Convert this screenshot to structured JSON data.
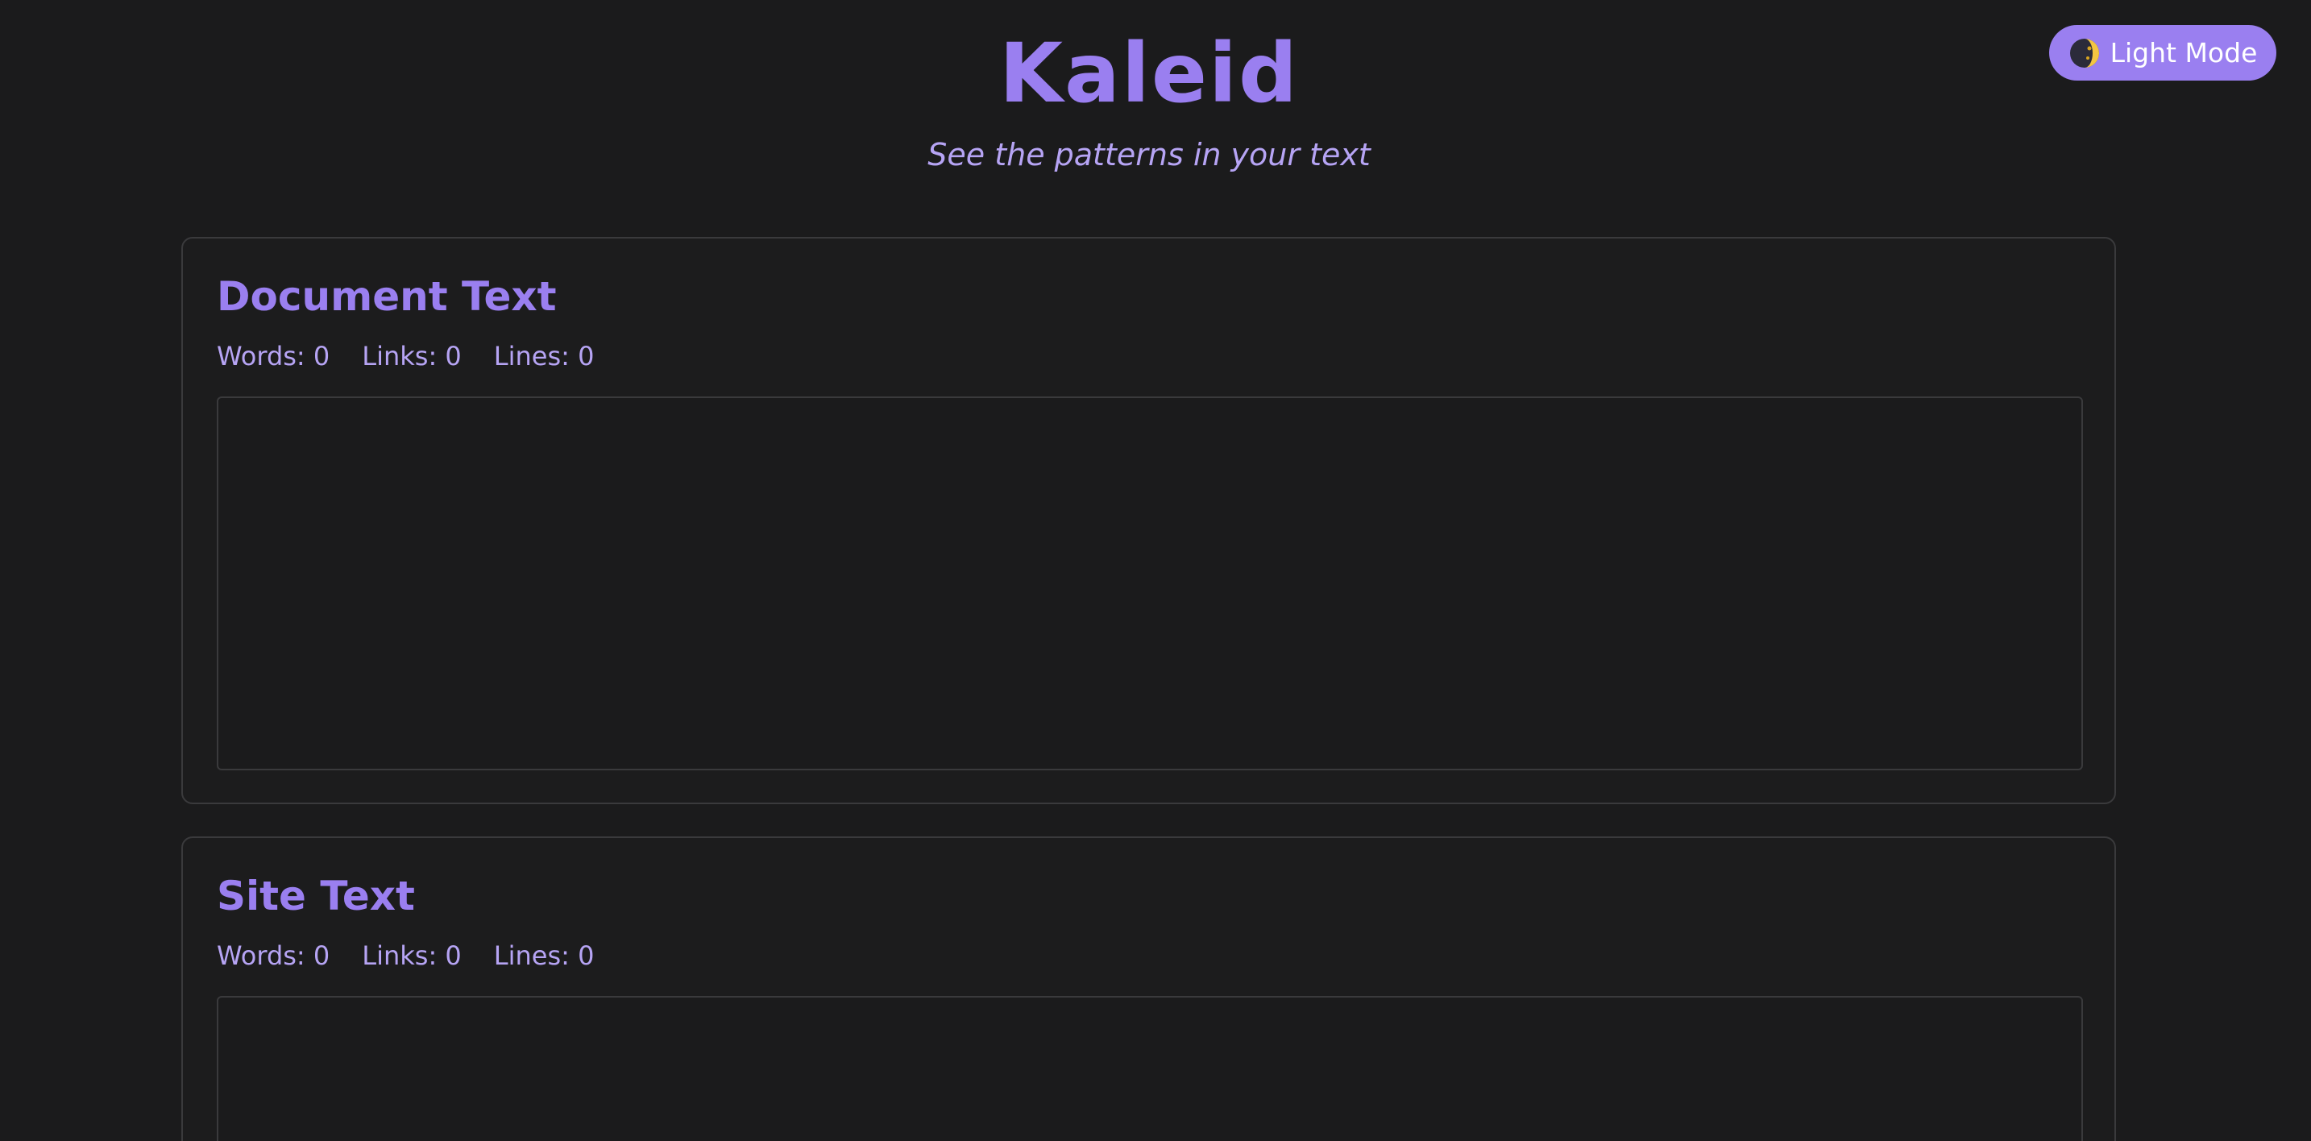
{
  "header": {
    "title": "Kaleid",
    "subtitle": "See the patterns in your text"
  },
  "theme_toggle": {
    "label": "Light Mode",
    "icon": "moon-icon"
  },
  "cards": [
    {
      "title": "Document Text",
      "stats": {
        "words": "Words: 0",
        "links": "Links: 0",
        "lines": "Lines: 0"
      },
      "textarea_value": ""
    },
    {
      "title": "Site Text",
      "stats": {
        "words": "Words: 0",
        "links": "Links: 0",
        "lines": "Lines: 0"
      },
      "textarea_value": ""
    }
  ],
  "colors": {
    "background": "#1b1b1c",
    "accent": "#9a7ff0",
    "accent_light": "#b6a4f4",
    "border": "#3a3a3c"
  }
}
